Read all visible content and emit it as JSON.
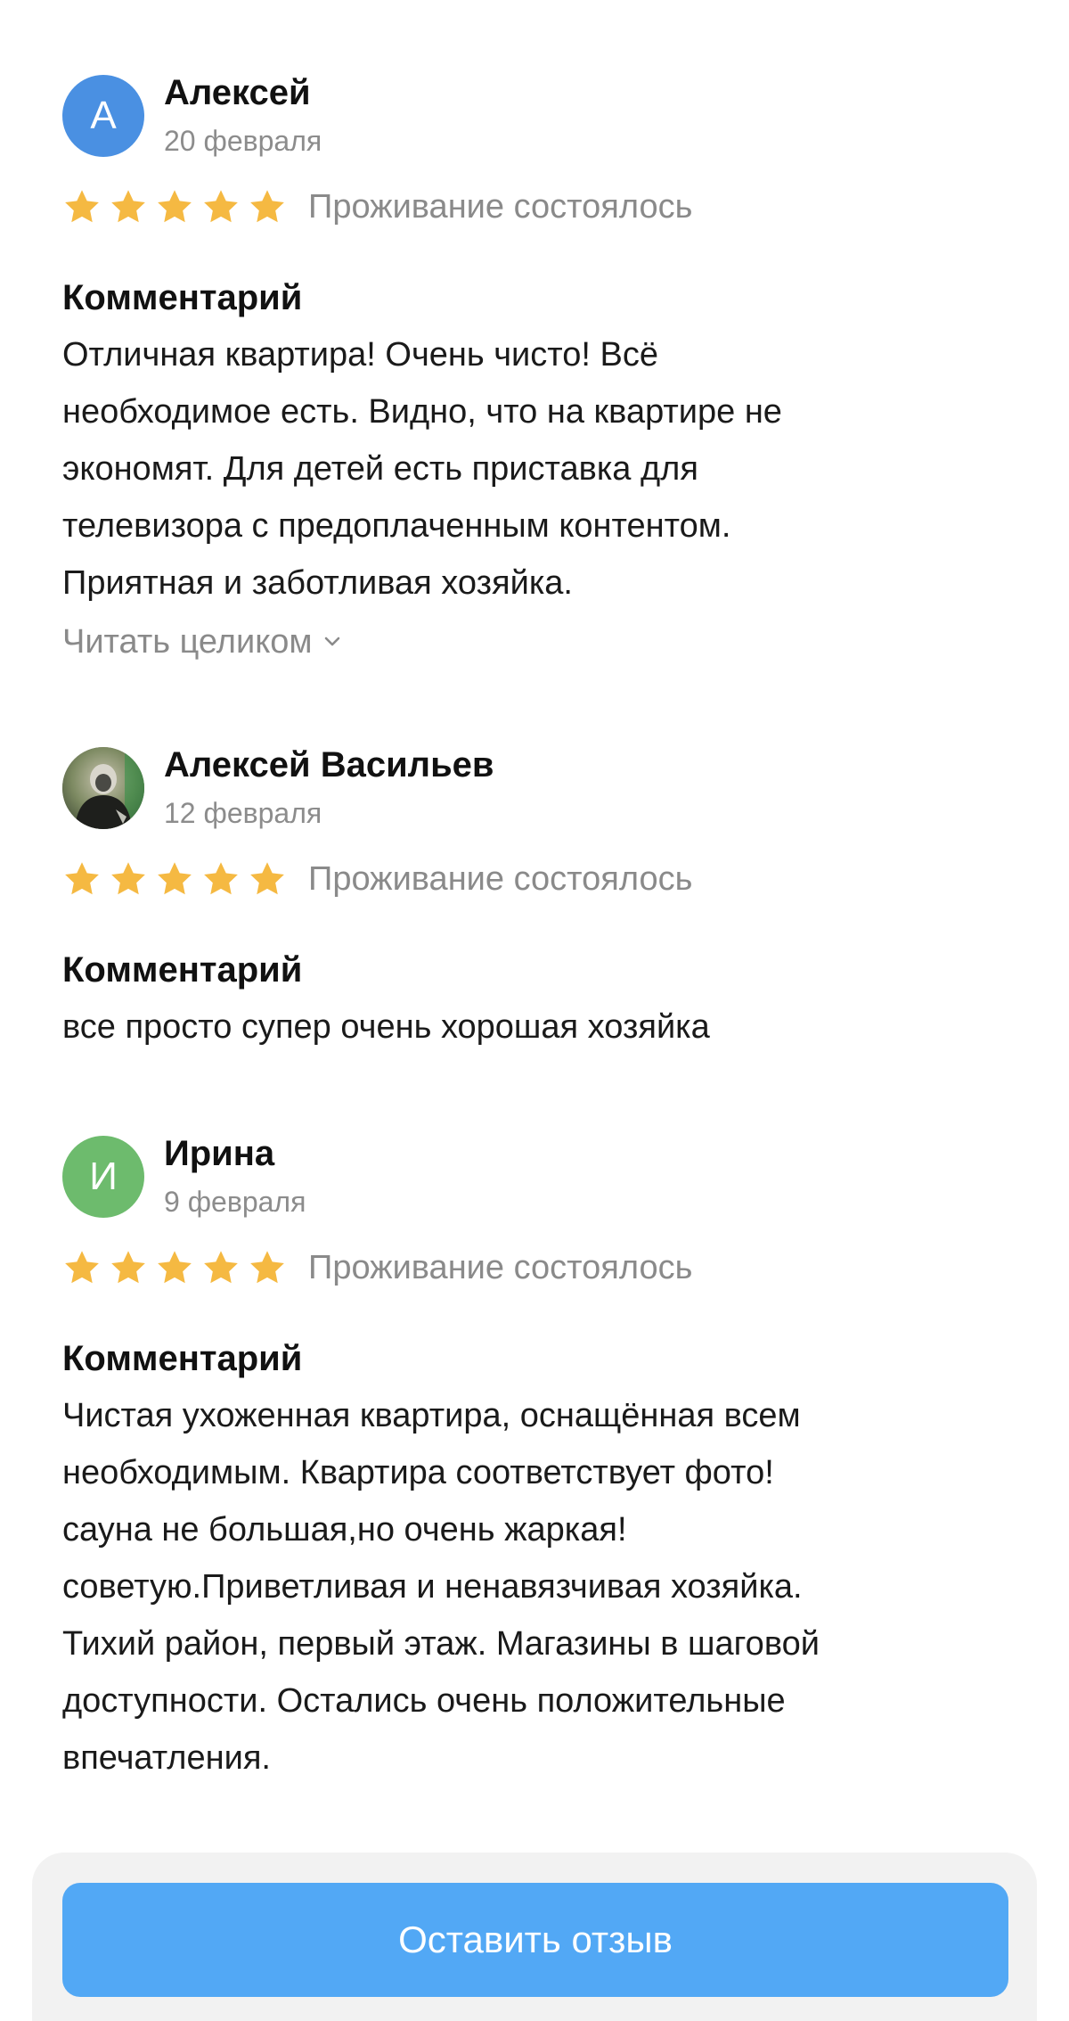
{
  "reviews": [
    {
      "avatar_letter": "А",
      "avatar_color": "#4a90e2",
      "author": "Алексей",
      "date": "20 февраля",
      "rating": 5,
      "status": "Проживание состоялось",
      "comment_title": "Комментарий",
      "comment": "Отличная квартира! Очень чисто! Всё\nнеобходимое есть. Видно, что на квартире не\nэкономят. Для детей есть приставка для\nтелевизора с предоплаченным контентом.\nПриятная и заботливая хозяйка.",
      "read_more": "Читать целиком"
    },
    {
      "avatar_letter": "",
      "avatar_color": "#6b6f5e",
      "author": "Алексей Васильев",
      "date": "12 февраля",
      "rating": 5,
      "status": "Проживание состоялось",
      "comment_title": "Комментарий",
      "comment": "все просто супер очень хорошая хозяйка"
    },
    {
      "avatar_letter": "И",
      "avatar_color": "#6dbb6d",
      "author": "Ирина",
      "date": "9 февраля",
      "rating": 5,
      "status": "Проживание состоялось",
      "comment_title": "Комментарий",
      "comment": "Чистая ухоженная квартира, оснащённая всем\nнеобходимым. Квартира соответствует фото!\nсауна не большая,но очень жаркая!\nсоветую.Приветливая и ненавязчивая хозяйка.\nТихий район, первый этаж. Магазины в  шаговой\nдоступности. Остались очень положительные\nвпечатления."
    }
  ],
  "star_color": "#f5b942",
  "primary_button": {
    "label": "Оставить отзыв",
    "color": "#52a8f5"
  }
}
